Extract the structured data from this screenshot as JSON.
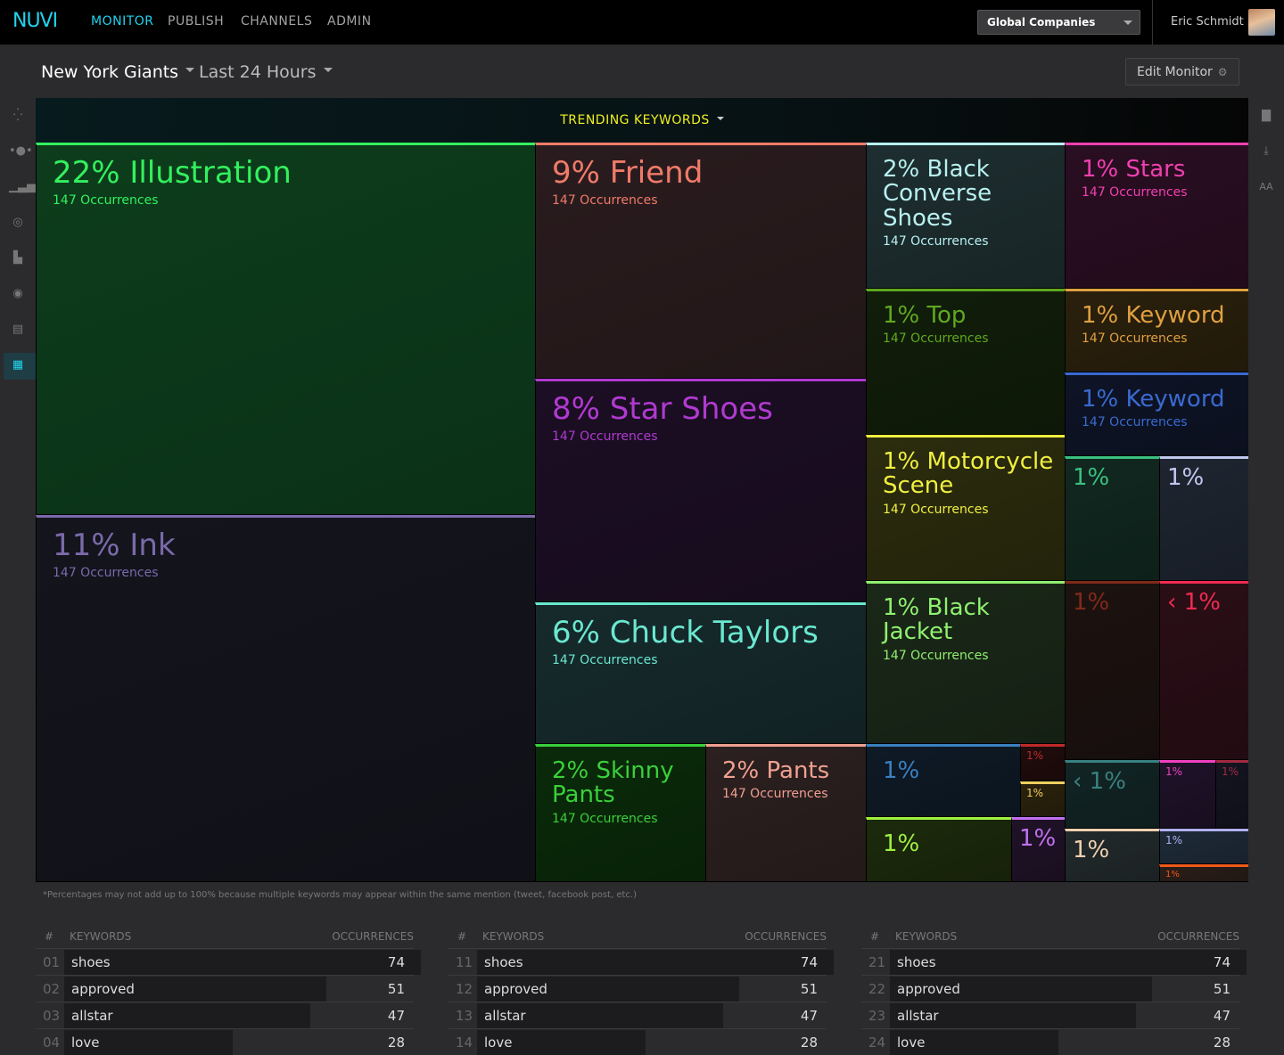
{
  "app": {
    "logo": "NUVI"
  },
  "nav": {
    "monitor": "MONITOR",
    "publish": "PUBLISH",
    "channels": "CHANNELS",
    "admin": "ADMIN"
  },
  "company_select": {
    "value": "Global Companies"
  },
  "user": {
    "name": "Eric Schmidt"
  },
  "subheader": {
    "monitor": "New York Giants",
    "range": "Last 24 Hours",
    "edit": "Edit Monitor"
  },
  "treemap": {
    "title": "TRENDING KEYWORDS",
    "footnote": "*Percentages may not add up to 100% because multiple keywords may appear within the same mention (tweet, facebook post, etc.)",
    "cells": [
      {
        "label": "22% Illustration",
        "sub": "147 Occurrences",
        "color": "#33f05e",
        "bg": "#0d3d1c"
      },
      {
        "label": "11% Ink",
        "sub": "147 Occurrences",
        "color": "#7a6aaa",
        "bg": "#14141d"
      },
      {
        "label": "9% Friend",
        "sub": "147 Occurrences",
        "color": "#f07a6a",
        "bg": "#2a1c1e"
      },
      {
        "label": "8% Star Shoes",
        "sub": "147 Occurrences",
        "color": "#b03ad0",
        "bg": "#1c0e24"
      },
      {
        "label": "6% Chuck Taylors",
        "sub": "147 Occurrences",
        "color": "#6ae8d0",
        "bg": "#162a2c"
      },
      {
        "label": "2% Skinny Pants",
        "sub": "147 Occurrences",
        "color": "#3ad03a",
        "bg": "#0a2a0a"
      },
      {
        "label": "2% Pants",
        "sub": "147 Occurrences",
        "color": "#f0a090",
        "bg": "#2c2020"
      },
      {
        "label": "2% Black Converse Shoes",
        "sub": "147 Occurrences",
        "color": "#b8f0f0",
        "bg": "#1e2e30"
      },
      {
        "label": "1% Top",
        "sub": "147 Occurrences",
        "color": "#60a820",
        "bg": "#111e0a"
      },
      {
        "label": "1% Motorcycle Scene",
        "sub": "147 Occurrences",
        "color": "#f0f040",
        "bg": "#2c2c0e"
      },
      {
        "label": "1% Black Jacket",
        "sub": "147 Occurrences",
        "color": "#90f070",
        "bg": "#1a2818"
      },
      {
        "label": "1% Stars",
        "sub": "147 Occurrences",
        "color": "#f040b0",
        "bg": "#2a0e22"
      },
      {
        "label": "1% Keyword",
        "sub": "147 Occurrences",
        "color": "#e0a040",
        "bg": "#2a200c"
      },
      {
        "label": "1% Keyword",
        "sub": "147 Occurrences",
        "color": "#3a6ad0",
        "bg": "#0e1426"
      },
      {
        "label": "1%",
        "color": "#3ac080",
        "bg": "#112820"
      },
      {
        "label": "1%",
        "color": "#c0c8f0",
        "bg": "#1e2530"
      },
      {
        "label": "1%",
        "color": "#802a1a",
        "bg": "#1c1210"
      },
      {
        "label": "‹ 1%",
        "color": "#f02a50",
        "bg": "#2a0e16"
      },
      {
        "label": "1%",
        "color": "#3a80c0",
        "bg": "#0e1a26"
      },
      {
        "label": "1%",
        "color": "#c02a2a",
        "bg": "#200c0c"
      },
      {
        "label": "1%",
        "color": "#f0d060",
        "bg": "#2a220c"
      },
      {
        "label": "1%",
        "color": "#a0f040",
        "bg": "#1c2a0c"
      },
      {
        "label": "1%",
        "color": "#c070f0",
        "bg": "#201228"
      },
      {
        "label": "‹ 1%",
        "color": "#3a8080",
        "bg": "#122424"
      },
      {
        "label": "1%",
        "color": "#f040c0",
        "bg": "#1e1228"
      },
      {
        "label": "1%",
        "color": "#a02a40",
        "bg": "#141420"
      },
      {
        "label": "1%",
        "color": "#f0d0b0",
        "bg": "#222a2c"
      },
      {
        "label": "1%",
        "color": "#b0b0f0",
        "bg": "#1e2a38"
      },
      {
        "label": "1%",
        "color": "#f05a1a",
        "bg": "#2a1e18"
      }
    ]
  },
  "tables": {
    "headers": {
      "num": "#",
      "keywords": "KEYWORDS",
      "occurrences": "OCCURRENCES"
    },
    "columns": [
      [
        {
          "num": "01",
          "keyword": "shoes",
          "value": "74"
        },
        {
          "num": "02",
          "keyword": "approved",
          "value": "51"
        },
        {
          "num": "03",
          "keyword": "allstar",
          "value": "47"
        },
        {
          "num": "04",
          "keyword": "love",
          "value": "28"
        }
      ],
      [
        {
          "num": "11",
          "keyword": "shoes",
          "value": "74"
        },
        {
          "num": "12",
          "keyword": "approved",
          "value": "51"
        },
        {
          "num": "13",
          "keyword": "allstar",
          "value": "47"
        },
        {
          "num": "14",
          "keyword": "love",
          "value": "28"
        }
      ],
      [
        {
          "num": "21",
          "keyword": "shoes",
          "value": "74"
        },
        {
          "num": "22",
          "keyword": "approved",
          "value": "51"
        },
        {
          "num": "23",
          "keyword": "allstar",
          "value": "47"
        },
        {
          "num": "24",
          "keyword": "love",
          "value": "28"
        }
      ]
    ]
  }
}
